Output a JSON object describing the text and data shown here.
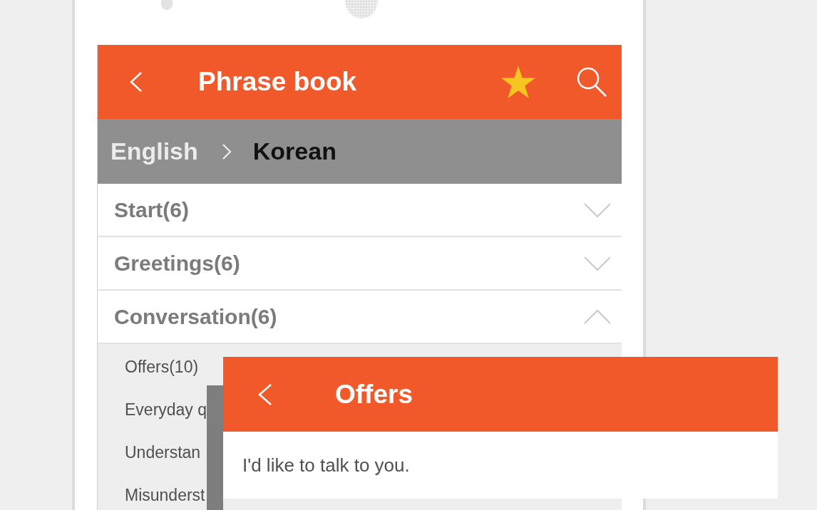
{
  "app_bar": {
    "title": "Phrase book"
  },
  "language_bar": {
    "source": "English",
    "target": "Korean"
  },
  "categories": [
    {
      "label": "Start(6)",
      "expanded": false
    },
    {
      "label": "Greetings(6)",
      "expanded": false
    },
    {
      "label": "Conversation(6)",
      "expanded": true,
      "children": [
        {
          "label": "Offers(10)"
        },
        {
          "label": "Everyday q"
        },
        {
          "label": "Understan"
        },
        {
          "label": "Misunderst"
        }
      ]
    }
  ],
  "phrase_card": {
    "title": "Offers",
    "phrases": [
      "I'd like to talk to you."
    ]
  }
}
